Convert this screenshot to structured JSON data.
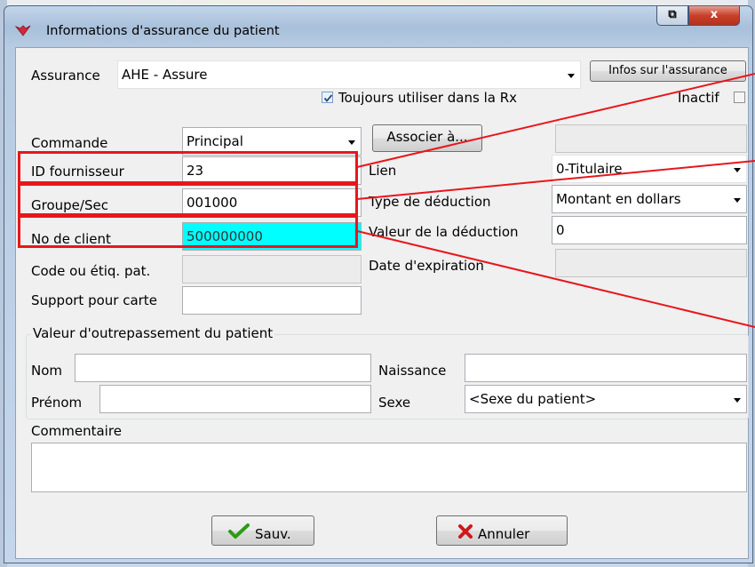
{
  "window": {
    "title": "Informations d'assurance du patient",
    "close_glyph": "x",
    "restore_glyph": "⧉"
  },
  "assurance": {
    "label": "Assurance",
    "value": "AHE - Assure",
    "info_button": "Infos sur l'assurance"
  },
  "options": {
    "toujours_label": "Toujours utiliser dans la Rx",
    "toujours_checked": true,
    "inactif_label": "Inactif",
    "inactif_checked": false
  },
  "left_fields": {
    "commande": {
      "label": "Commande",
      "value": "Principal"
    },
    "id_fournisseur": {
      "label": "ID fournisseur",
      "value": "23"
    },
    "groupe": {
      "label": "Groupe/Sec",
      "value": "001000"
    },
    "no_client": {
      "label": "No de client",
      "value": "500000000"
    },
    "code": {
      "label": "Code ou étiq. pat.",
      "value": ""
    },
    "support": {
      "label": "Support pour carte",
      "value": ""
    }
  },
  "right_fields": {
    "associer_button": "Associer à...",
    "lien": {
      "label": "Lien",
      "value": "0-Titulaire"
    },
    "type_deduction": {
      "label": "Type de déduction",
      "value": "Montant en dollars"
    },
    "valeur_deduction": {
      "label": "Valeur de la déduction",
      "value": "0"
    },
    "date_expiration": {
      "label": "Date d'expiration",
      "value": ""
    }
  },
  "override": {
    "title": "Valeur d'outrepassement du patient",
    "nom": {
      "label": "Nom",
      "value": ""
    },
    "prenom": {
      "label": "Prénom",
      "value": ""
    },
    "naissance": {
      "label": "Naissance",
      "value": ""
    },
    "sexe": {
      "label": "Sexe",
      "value": "<Sexe du patient>"
    }
  },
  "commentaire": {
    "label": "Commentaire",
    "value": ""
  },
  "buttons": {
    "save": "Sauv.",
    "cancel": "Annuler"
  },
  "colors": {
    "highlight_field": "#00ffff",
    "annotation": "#e8161c",
    "save_check": "#2e9c14",
    "cancel_x": "#cc1a1a"
  }
}
